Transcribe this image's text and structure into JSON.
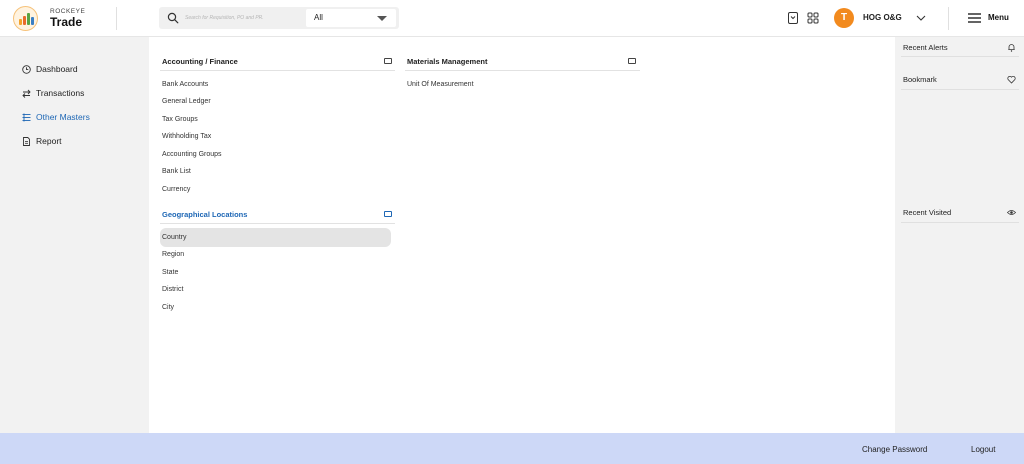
{
  "brand": {
    "top": "ROCKEYE",
    "name": "Trade"
  },
  "search": {
    "placeholder": "Search for Requisition, PO and PR.",
    "filter_selected": "All"
  },
  "header": {
    "avatar_initial": "T",
    "user_name": "HOG O&G",
    "menu_label": "Menu"
  },
  "sidebar": {
    "items": [
      {
        "label": "Dashboard",
        "icon": "clock-icon"
      },
      {
        "label": "Transactions",
        "icon": "swap-arrows-icon"
      },
      {
        "label": "Other Masters",
        "icon": "list-icon",
        "active": true
      },
      {
        "label": "Report",
        "icon": "document-icon"
      }
    ]
  },
  "sections": {
    "accounting": {
      "title": "Accounting / Finance",
      "items": [
        "Bank Accounts",
        "General Ledger",
        "Tax Groups",
        "Withholding Tax",
        "Accounting Groups",
        "Bank List",
        "Currency"
      ]
    },
    "geo": {
      "title": "Geographical Locations",
      "items": [
        "Country",
        "Region",
        "State",
        "District",
        "City"
      ],
      "selected": "Country"
    },
    "materials": {
      "title": "Materials Management",
      "items": [
        "Unit Of Measurement"
      ]
    }
  },
  "right_panel": {
    "recent_alerts": "Recent Alerts",
    "bookmark": "Bookmark",
    "recent_visited": "Recent Visited"
  },
  "footer": {
    "change_password": "Change Password",
    "logout": "Logout"
  },
  "colors": {
    "accent_blue": "#1e67b5",
    "avatar_orange": "#f28a1e",
    "footer_bg": "#cdd8f7"
  }
}
